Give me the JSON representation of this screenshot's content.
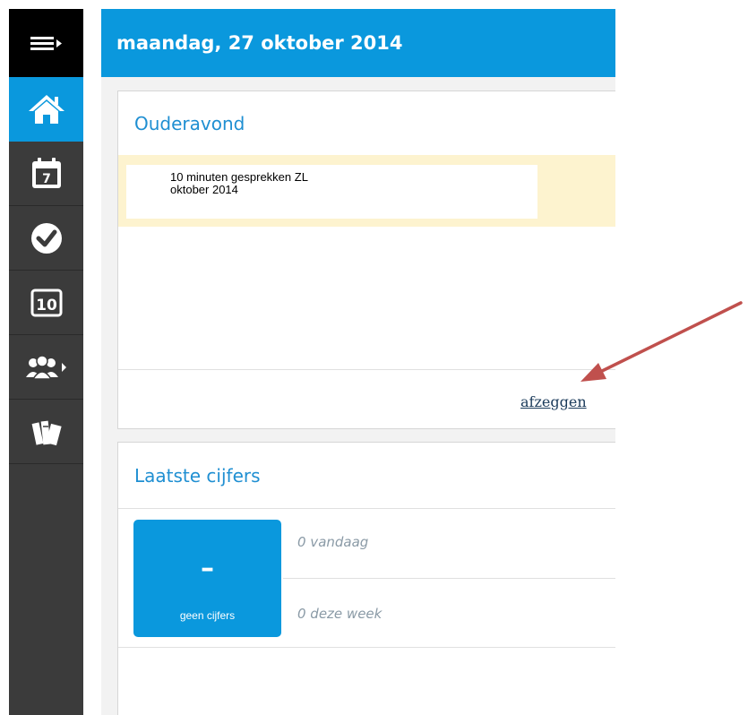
{
  "header": {
    "date": "maandag, 27 oktober 2014"
  },
  "sidebar": {
    "items": [
      {
        "icon": "menu-icon"
      },
      {
        "icon": "home-icon",
        "active": true
      },
      {
        "icon": "calendar-icon",
        "text": "7"
      },
      {
        "icon": "check-icon"
      },
      {
        "icon": "grades-icon",
        "text": "10"
      },
      {
        "icon": "group-icon"
      },
      {
        "icon": "books-icon"
      }
    ]
  },
  "ouderavond": {
    "title": "Ouderavond",
    "event_line1": "10 minuten gesprekken ZL",
    "event_line2": "oktober 2014",
    "cancel_link": "afzeggen"
  },
  "laatste_cijfers": {
    "title": "Laatste cijfers",
    "tile_value": "–",
    "tile_label": "geen cijfers",
    "today": "0 vandaag",
    "this_week": "0 deze week"
  },
  "colors": {
    "accent": "#0a98dd",
    "sidebar": "#3b3b3b",
    "event_band": "#fdf3cf",
    "annotation_arrow": "#c0504d"
  }
}
